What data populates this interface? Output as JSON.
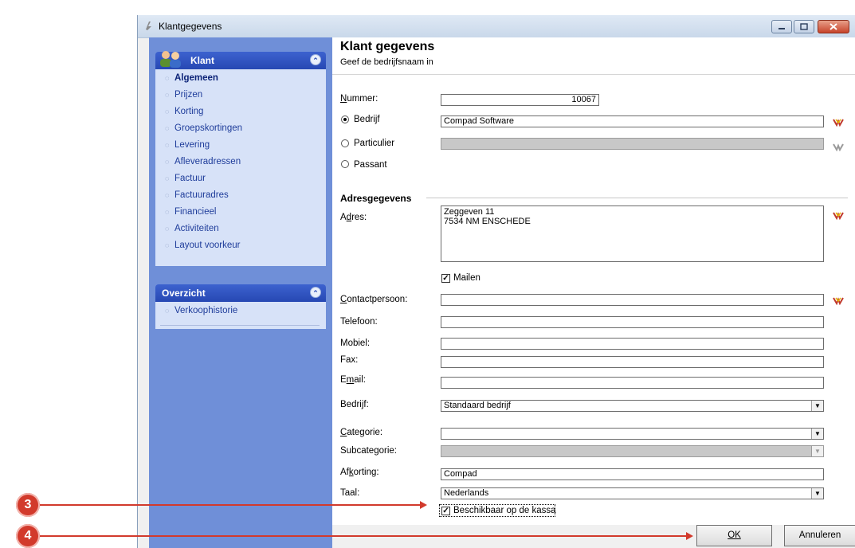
{
  "window": {
    "title": "Klantgegevens"
  },
  "left_panel": {
    "klant": {
      "header": "Klant",
      "items": [
        "Algemeen",
        "Prijzen",
        "Korting",
        "Groepskortingen",
        "Levering",
        "Afleveradressen",
        "Factuur",
        "Factuuradres",
        "Financieel",
        "Activiteiten",
        "Layout voorkeur"
      ],
      "active_index": 0
    },
    "overzicht": {
      "header": "Overzicht",
      "items": [
        "Verkoophistorie"
      ]
    }
  },
  "form": {
    "heading": "Klant gegevens",
    "subheading": "Geef de bedrijfsnaam in",
    "nummer": {
      "label": "Nummer:",
      "value": "10067"
    },
    "type_options": [
      {
        "label": "Bedrijf",
        "selected": true,
        "value": "Compad Software"
      },
      {
        "label": "Particulier",
        "selected": false,
        "value": ""
      },
      {
        "label": "Passant",
        "selected": false
      }
    ],
    "section_title": "Adresgegevens",
    "adres": {
      "label": "Adres:",
      "line1": "Zeggeven 11",
      "line2": "7534 NM  ENSCHEDE"
    },
    "mailen": {
      "label": "Mailen",
      "checked": true
    },
    "contactpersoon": {
      "label": "Contactpersoon:",
      "value": ""
    },
    "telefoon": {
      "label": "Telefoon:",
      "value": ""
    },
    "mobiel": {
      "label": "Mobiel:",
      "value": ""
    },
    "fax": {
      "label": "Fax:",
      "value": ""
    },
    "email": {
      "label": "Email:",
      "value": ""
    },
    "bedrijf": {
      "label": "Bedrijf:",
      "value": "Standaard bedrijf"
    },
    "categorie": {
      "label": "Categorie:",
      "value": ""
    },
    "subcategorie": {
      "label": "Subcategorie:",
      "value": ""
    },
    "afkorting": {
      "label": "Afkorting:",
      "value": "Compad"
    },
    "taal": {
      "label": "Taal:",
      "value": "Nederlands"
    },
    "kassa": {
      "label": "Beschikbaar op de kassa",
      "checked": true
    }
  },
  "buttons": {
    "ok": "OK",
    "cancel": "Annuleren"
  },
  "annotations": {
    "step3": "3",
    "step4": "4",
    "color": "#d23a2c"
  },
  "colors": {
    "left_panel_bg": "#6f8fd8",
    "panel_header": "#2748b3",
    "panel_body": "#d7e2f8",
    "nav_link": "#1e3c9a"
  }
}
